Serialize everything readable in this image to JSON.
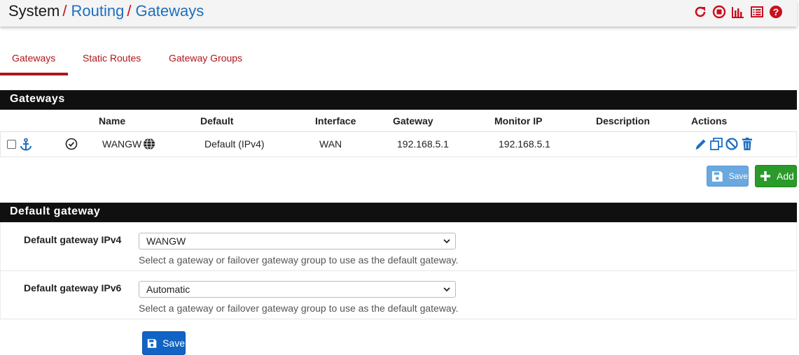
{
  "breadcrumb": {
    "root": "System",
    "sep1": "/",
    "item1": "Routing",
    "sep2": "/",
    "item2": "Gateways"
  },
  "header_icons": [
    "reload-icon",
    "stop-icon",
    "chart-icon",
    "list-icon",
    "help-icon"
  ],
  "tabs": [
    {
      "label": "Gateways",
      "active": true
    },
    {
      "label": "Static Routes",
      "active": false
    },
    {
      "label": "Gateway Groups",
      "active": false
    }
  ],
  "gateways_panel": {
    "title": "Gateways",
    "columns": [
      "Name",
      "Default",
      "Interface",
      "Gateway",
      "Monitor IP",
      "Description",
      "Actions"
    ],
    "rows": [
      {
        "name": "WANGW",
        "default": "Default (IPv4)",
        "interface": "WAN",
        "gateway": "192.168.5.1",
        "monitor_ip": "192.168.5.1",
        "description": ""
      }
    ],
    "save_label": "Save",
    "add_label": "Add"
  },
  "default_gateway_panel": {
    "title": "Default gateway",
    "ipv4_label": "Default gateway IPv4",
    "ipv4_value": "WANGW",
    "ipv4_help": "Select a gateway or failover gateway group to use as the default gateway.",
    "ipv6_label": "Default gateway IPv6",
    "ipv6_value": "Automatic",
    "ipv6_help": "Select a gateway or failover gateway group to use as the default gateway.",
    "save_label": "Save"
  },
  "colors": {
    "accent_red": "#b0161a",
    "link_blue": "#1d6fbf",
    "panel_black": "#101010",
    "add_green": "#2a9a2a",
    "save_blue": "#1264c4",
    "save_light_blue": "#6aa8e0"
  }
}
